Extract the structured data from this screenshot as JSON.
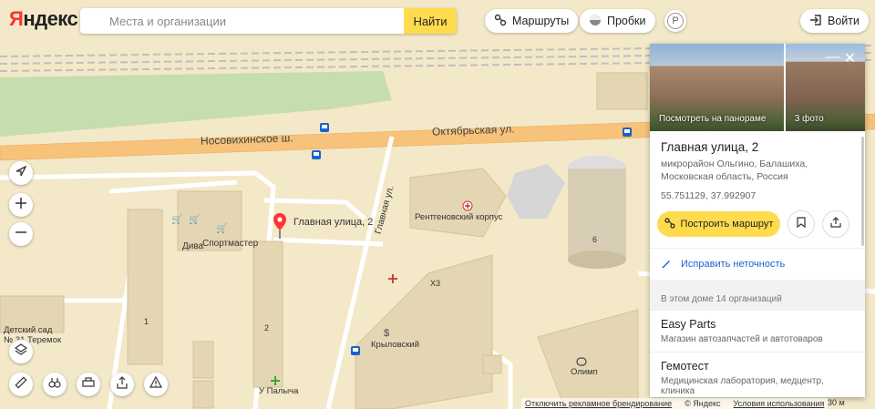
{
  "brand": {
    "logo_first": "Я",
    "logo_rest": "ндекс"
  },
  "search": {
    "placeholder": "Места и организации",
    "button": "Найти"
  },
  "header": {
    "routes": "Маршруты",
    "traffic": "Пробки",
    "parking": "P",
    "login": "Войти"
  },
  "map_labels": {
    "road1": "Носовихинское ш.",
    "road2": "Октябрьская ул.",
    "road3": "Главная ул.",
    "marker": "Главная улица, 2",
    "diva": "Дива",
    "sportmaster": "Спортмастер",
    "xray": "Рентгеновский корпус",
    "krylovsky": "Крыловский",
    "olimp": "Олимп",
    "kindergarten_line1": "Детский сад",
    "kindergarten_line2": "№ 31 Теремок",
    "palycha": "У Палыча",
    "num1": "1",
    "num2": "2",
    "num6": "6",
    "num_x3": "Х3"
  },
  "panel": {
    "photo_panorama": "Посмотреть на панораме",
    "photo_count": "3 фото",
    "title": "Главная улица, 2",
    "address": "микрорайон Ольгино, Балашиха, Московская область, Россия",
    "coords": "55.751129, 37.992907",
    "build_route": "Построить маршрут",
    "fix": "Исправить неточность",
    "org_count": "В этом доме 14 организаций",
    "orgs": [
      {
        "name": "Easy Parts",
        "desc": "Магазин автозапчастей и автотоваров"
      },
      {
        "name": "Гемотест",
        "desc": "Медицинская лаборатория, медцентр, клиника"
      }
    ]
  },
  "footer": {
    "disable_ads": "Отключить рекламное брендирование",
    "copyright": "© Яндекс",
    "terms": "Условия использования",
    "scale": "30 м"
  },
  "colors": {
    "accent": "#ffdb4d",
    "link": "#1a61d1",
    "marker": "#f33",
    "road": "#f7c27a"
  },
  "icons": [
    "routes-icon",
    "traffic-icon",
    "login-icon",
    "location-icon",
    "zoom-in-icon",
    "zoom-out-icon",
    "layers-icon",
    "ruler-icon",
    "panorama-icon",
    "print-icon",
    "share-icon",
    "warning-icon",
    "close-icon",
    "minimize-icon",
    "route-icon",
    "bookmark-icon",
    "share-icon",
    "pencil-icon"
  ]
}
